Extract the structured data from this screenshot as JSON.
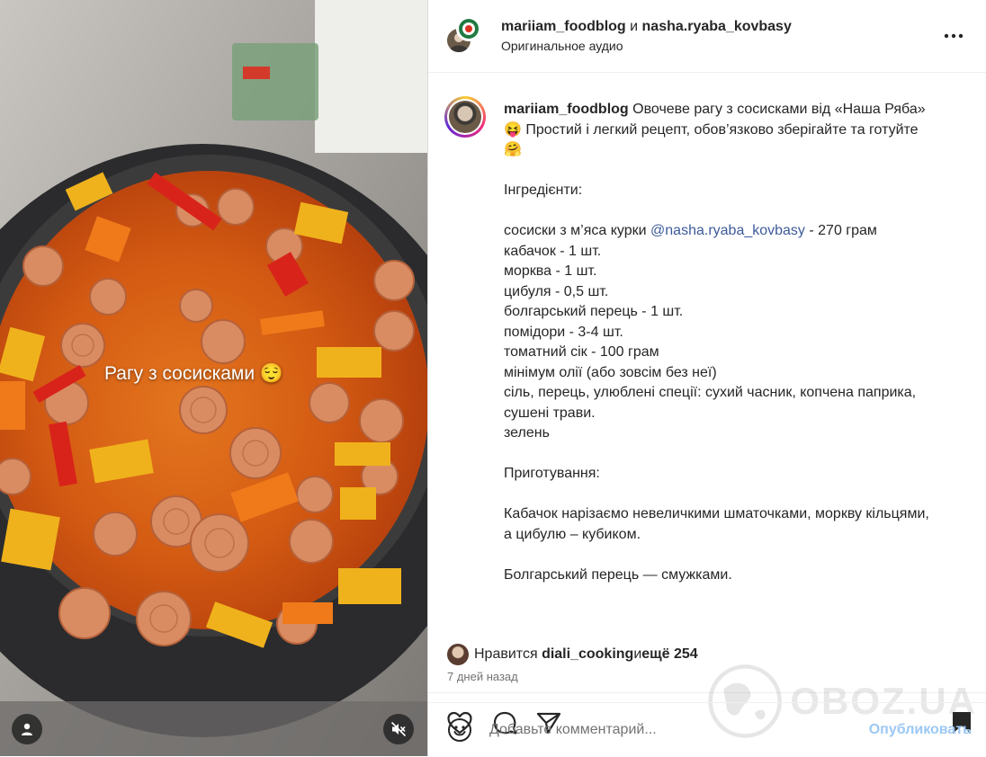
{
  "post": {
    "header": {
      "author1": "mariiam_foodblog",
      "conjunction": "и",
      "author2": "nasha.ryaba_kovbasy",
      "audio": "Оригинальное аудио"
    },
    "media": {
      "overlay_text": "Рагу з сосисками 😌",
      "icons": [
        "user-tag-icon",
        "muted-speaker-icon"
      ]
    },
    "caption": {
      "username": "mariiam_foodblog",
      "title_text": " Овочеве рагу з сосисками від «Наша Ряба»",
      "line2": "😝 Простий і легкий рецепт, обов’язково зберігайте та готуйте",
      "line3": "🤗",
      "ingredients_heading": "Інгредієнти:",
      "sausage_prefix": "сосиски з м’яса курки ",
      "mention": "@nasha.ryaba_kovbasy",
      "sausage_suffix": " - 270 грам",
      "ingredients": [
        "кабачок - 1 шт.",
        "морква - 1 шт.",
        "цибуля - 0,5 шт.",
        "болгарський перець - 1 шт.",
        "помідори - 3-4 шт.",
        "томатний сік - 100 грам",
        "мінімум олії (або зовсім без неї)",
        "сіль, перець, улюблені спеції: сухий часник, копчена паприка,",
        "сушені трави.",
        "зелень"
      ],
      "method_heading": "Приготування:",
      "step1_line1": "Кабачок нарізаємо невеличкими шматочками, моркву кільцями,",
      "step1_line2": "а цибулю – кубиком.",
      "step2": "Болгарський перець — смужками."
    },
    "likes": {
      "prefix": "Нравится ",
      "user": "diali_cooking",
      "middle": " и ",
      "others": "ещё 254"
    },
    "time": "7 дней назад",
    "comment": {
      "placeholder": "Добавьте комментарий...",
      "publish_label": "Опубликовать"
    },
    "watermark": "OBOZ.UA"
  },
  "colors": {
    "mention": "#3d5a9a",
    "publish": "#9cc8f3",
    "muted_text": "#737373"
  }
}
